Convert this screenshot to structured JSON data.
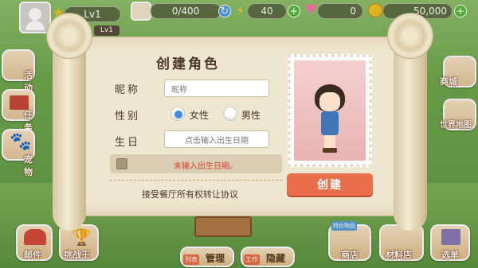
{
  "hud": {
    "level": "Lv1",
    "level_small": "Lv1",
    "capacity": "0/400",
    "energy": "40",
    "hearts": "0",
    "coins": "50,000"
  },
  "left_menu": [
    {
      "label": "活动"
    },
    {
      "label": "任务"
    },
    {
      "label": "宠物"
    }
  ],
  "right_menu": [
    {
      "label": "商城"
    },
    {
      "label": "世界地图"
    }
  ],
  "dialog": {
    "title": "创建角色",
    "nickname_label": "昵称",
    "nickname_placeholder": "昵称",
    "gender_label": "性别",
    "gender_female": "女性",
    "gender_male": "男性",
    "gender_selected": "female",
    "birthday_label": "生日",
    "birthday_placeholder": "点击输入出生日期",
    "warning": "未输入出生日期。",
    "agreement": "接受餐厅所有权转让协议",
    "create_button": "创建"
  },
  "bottom_bar": {
    "mail": "邮件",
    "challenge": "挑战王",
    "list_tag": "列表",
    "manage": "管理",
    "work_tag": "工作",
    "hide": "隐藏",
    "special_tag": "特价物品",
    "shop": "商店",
    "material_shop": "材料店",
    "menu": "选单"
  },
  "colors": {
    "create_button": "#e86f4a",
    "warning_text": "#d8402a",
    "radio_selected": "#3a8de0",
    "plus_green": "#56b83c"
  }
}
